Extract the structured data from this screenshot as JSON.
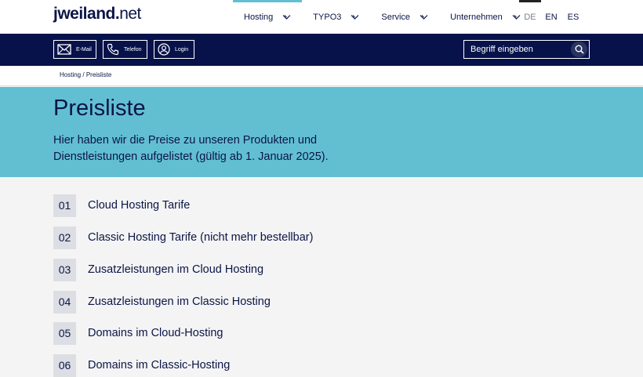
{
  "header": {
    "logo": {
      "brand": "jweiland",
      "dot": ".",
      "tld": "net"
    },
    "nav": [
      {
        "label": "Hosting",
        "active": true
      },
      {
        "label": "TYPO3",
        "active": false
      },
      {
        "label": "Service",
        "active": false
      },
      {
        "label": "Unternehmen",
        "active": false
      }
    ],
    "languages": [
      {
        "label": "DE",
        "active": true
      },
      {
        "label": "EN",
        "active": false
      },
      {
        "label": "ES",
        "active": false
      }
    ]
  },
  "toolbar": {
    "email_label": "E-Mail",
    "phone_label": "Telefon",
    "login_label": "Login",
    "search_placeholder": "Begriff eingeben"
  },
  "breadcrumb": {
    "items": [
      "Hosting",
      "Preisliste"
    ],
    "separator": "/"
  },
  "hero": {
    "title": "Preisliste",
    "intro": "Hier haben wir die Preise zu unseren Produkten und Dienstleistungen aufgelistet (gültig ab 1. Januar 2025)."
  },
  "sections": [
    {
      "number": "01",
      "title": "Cloud Hosting Tarife"
    },
    {
      "number": "02",
      "title": "Classic Hosting Tarife (nicht mehr bestellbar)"
    },
    {
      "number": "03",
      "title": "Zusatzleistungen im Cloud Hosting"
    },
    {
      "number": "04",
      "title": "Zusatzleistungen im Classic Hosting"
    },
    {
      "number": "05",
      "title": "Domains im Cloud-Hosting"
    },
    {
      "number": "06",
      "title": "Domains im Classic-Hosting"
    }
  ],
  "colors": {
    "navy": "#07124a",
    "accent": "#62bfd2",
    "text": "#0b1547"
  }
}
